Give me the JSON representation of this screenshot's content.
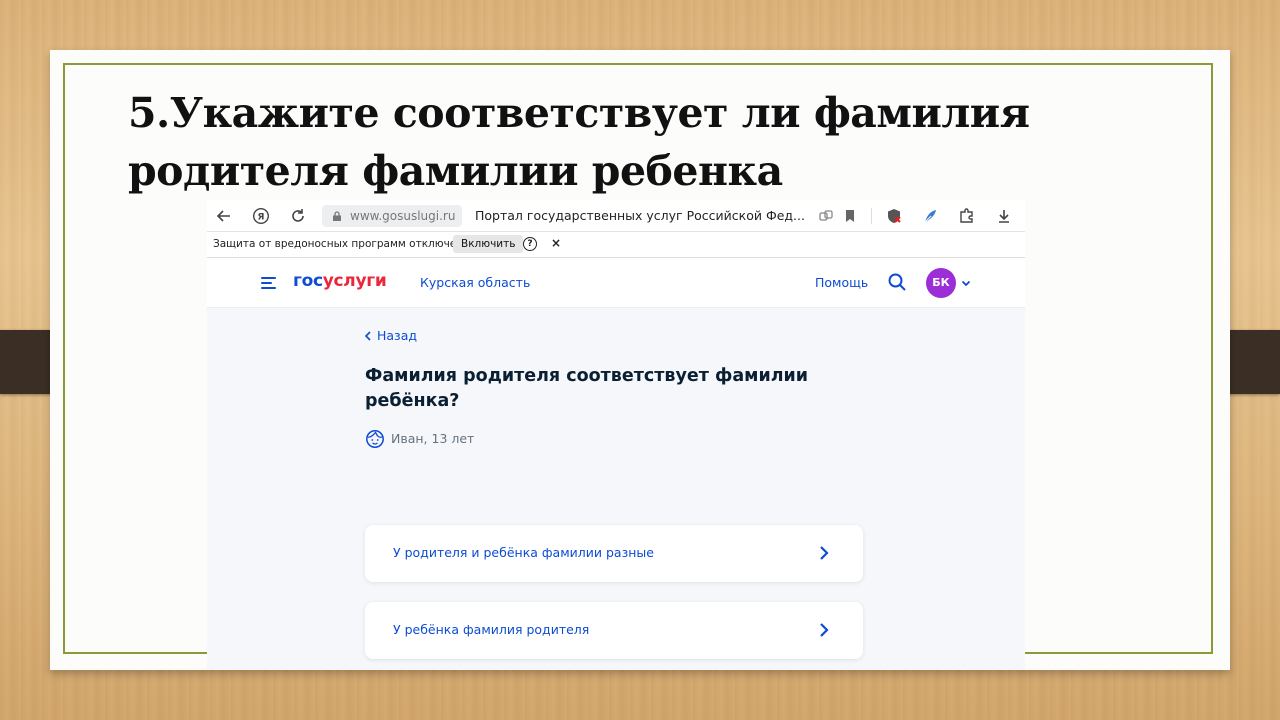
{
  "slide": {
    "title": "5.Укажите соответствует ли фамилия родителя фамилии ребенка"
  },
  "browser": {
    "url": "www.gosuslugi.ru",
    "page_title": "Портал государственных услуг Российской Фед...",
    "icons": [
      "back-icon",
      "yandex-icon",
      "reload-icon",
      "lock-icon",
      "copy-link-icon",
      "bookmark-icon",
      "protect-shield-icon",
      "extension-feather-icon",
      "extensions-puzzle-icon",
      "download-icon"
    ]
  },
  "notice": {
    "text": "Защита от вредоносных программ отключена",
    "enable_label": "Включить",
    "help_label": "?",
    "close_label": "×"
  },
  "header": {
    "logo_part1": "гос",
    "logo_part2": "услуги",
    "region": "Курская область",
    "help": "Помощь",
    "avatar_initials": "БК"
  },
  "content": {
    "back_label": "Назад",
    "question": "Фамилия родителя соответствует фамилии ребёнка?",
    "child": "Иван, 13 лет",
    "options": [
      {
        "label": "У родителя и ребёнка фамилии разные"
      },
      {
        "label": "У ребёнка фамилия родителя"
      }
    ]
  },
  "colors": {
    "accent": "#0d4cd3",
    "logo_red": "#e9283b",
    "avatar": "#9b2ed6",
    "frame": "#8a9a3a"
  }
}
